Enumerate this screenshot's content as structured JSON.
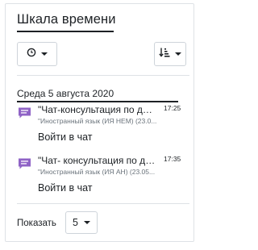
{
  "block": {
    "title": "Шкала времени",
    "filter_icon": "clock-icon",
    "sort_icon": "sort-by-dates-icon"
  },
  "timeline": {
    "date_heading": "Среда 5 августа 2020",
    "events": [
      {
        "icon": "chat-icon",
        "name": "\"Чат-консультация по ди...",
        "time": "17:25",
        "course": "\"Иностранный язык (ИЯ НЕМ) (23.0...",
        "action": "Войти в чат"
      },
      {
        "icon": "chat-icon",
        "name": "\"Чат- консультация по да...",
        "time": "17:35",
        "course": "\"Иностранный язык (ИЯ АН) (23.05...",
        "action": "Войти в чат"
      }
    ]
  },
  "footer": {
    "show_label": "Показать",
    "limit_value": "5"
  },
  "colors": {
    "chat_icon": "#8f63c6",
    "text": "#1d2125",
    "muted": "#6a737b",
    "border": "#dee2e6"
  }
}
